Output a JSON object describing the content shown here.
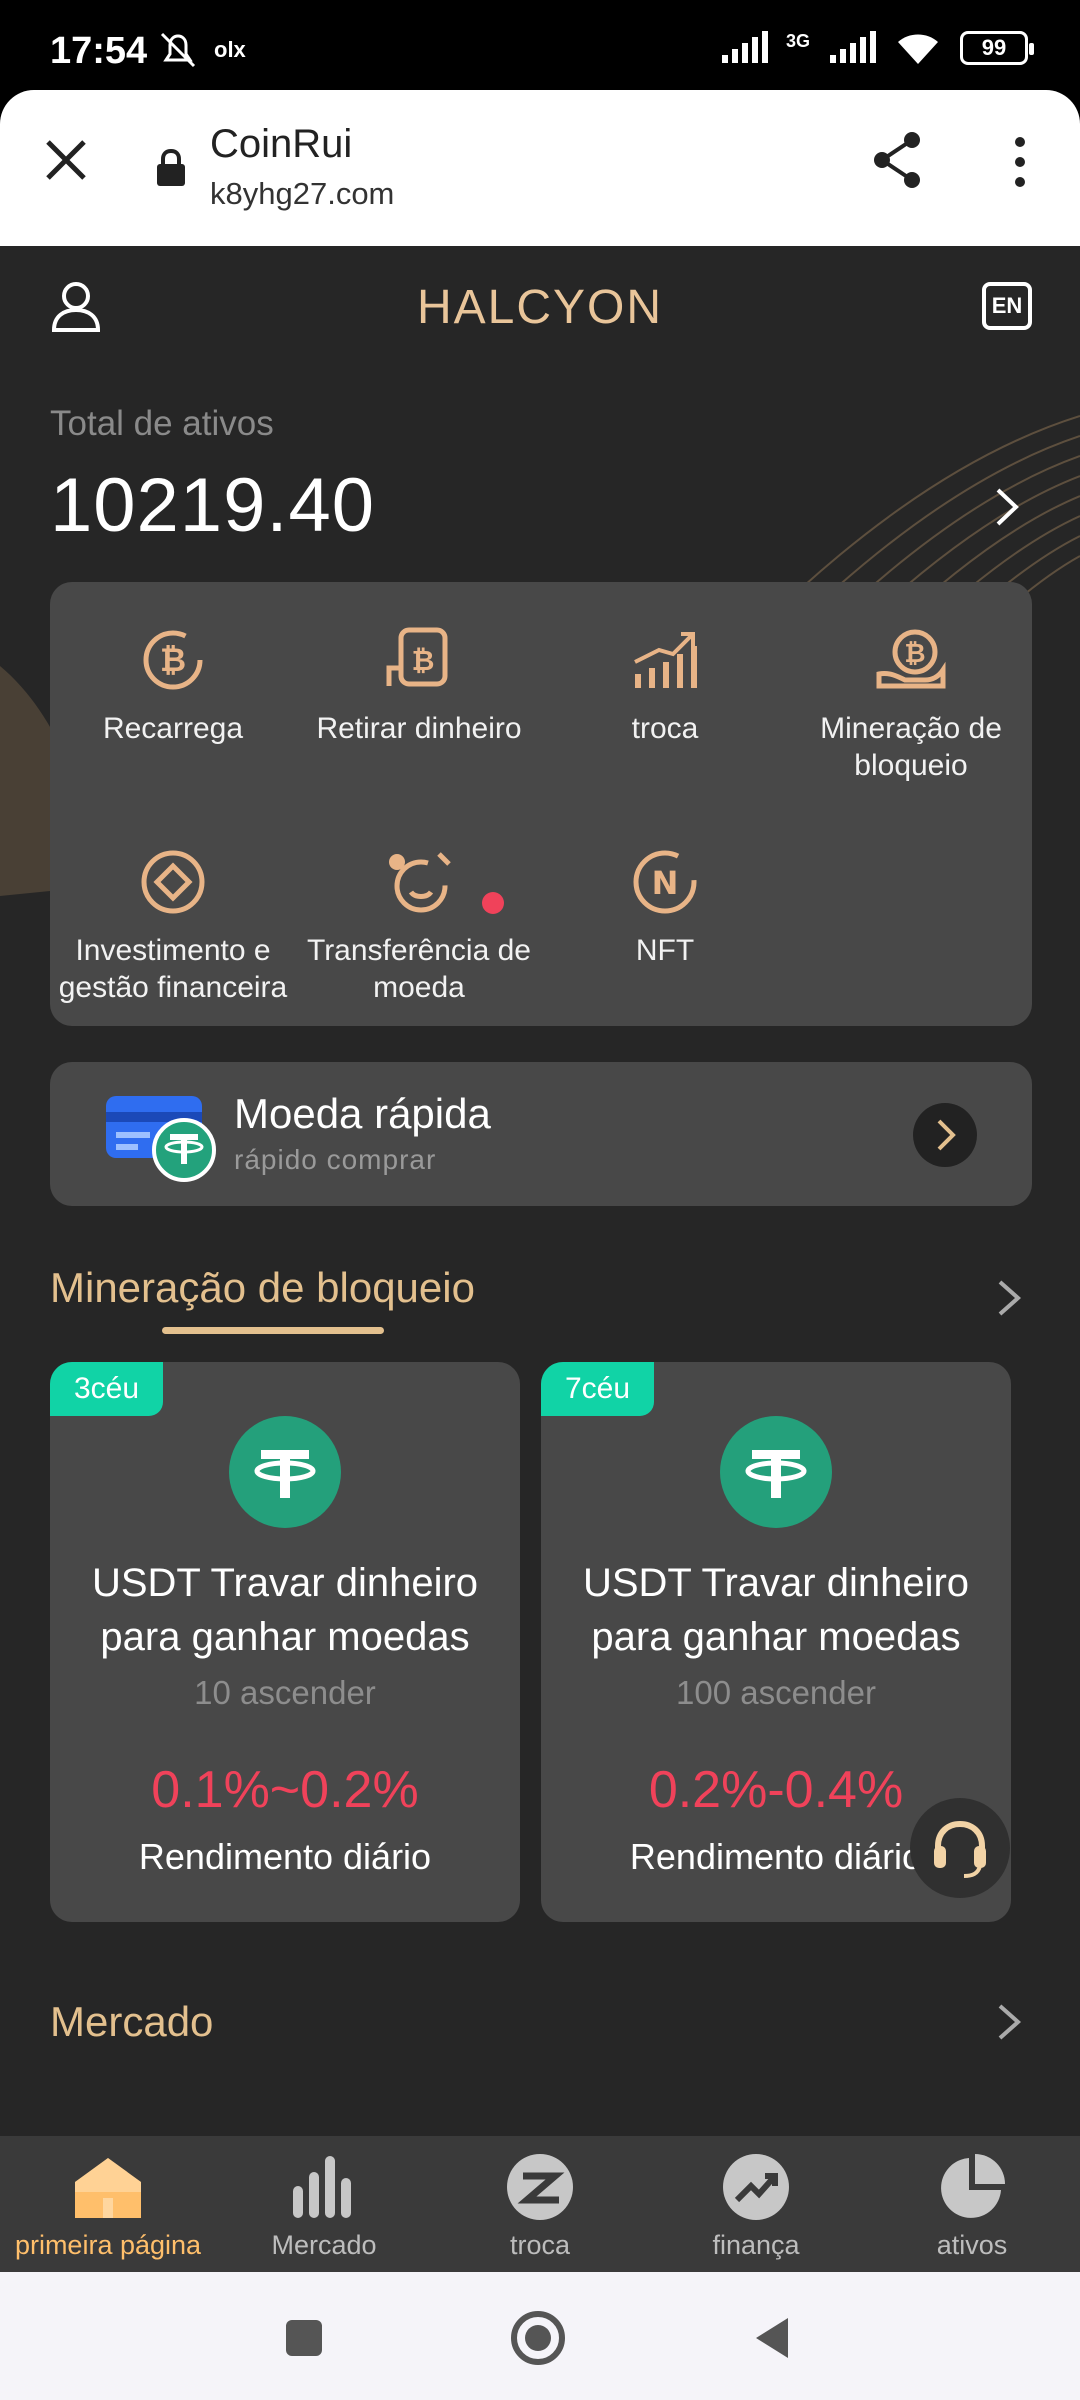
{
  "status_bar": {
    "time": "17:54",
    "network": "3G",
    "battery": "99"
  },
  "browser": {
    "title": "CoinRui",
    "url": "k8yhg27.com"
  },
  "header": {
    "brand": "HALCYON",
    "lang": "EN"
  },
  "assets": {
    "label": "Total de ativos",
    "value": "10219.40"
  },
  "menu": {
    "items": [
      {
        "label": "Recarrega",
        "icon": "bitcoin-cycle-icon"
      },
      {
        "label": "Retirar dinheiro",
        "icon": "bitcoin-withdraw-icon"
      },
      {
        "label": "troca",
        "icon": "trade-chart-icon"
      },
      {
        "label": "Mineração de bloqueio",
        "icon": "bitcoin-hand-icon"
      },
      {
        "label": "Investimento e gestão financeira",
        "icon": "diamond-circle-icon"
      },
      {
        "label": "Transferência de moeda",
        "icon": "alarm-transfer-icon"
      },
      {
        "label": "NFT",
        "icon": "nft-icon"
      }
    ]
  },
  "quick_coin": {
    "title": "Moeda rápida",
    "subtitle": "rápido comprar"
  },
  "mining_section": {
    "title": "Mineração de bloqueio",
    "cards": [
      {
        "badge": "3céu",
        "name_line1": "USDT Travar dinheiro",
        "name_line2": "para ganhar moedas",
        "min": "10 ascender",
        "rate": "0.1%~0.2%",
        "yield_label": "Rendimento diário"
      },
      {
        "badge": "7céu",
        "name_line1": "USDT Travar dinheiro",
        "name_line2": "para ganhar moedas",
        "min": "100 ascender",
        "rate": "0.2%-0.4%",
        "yield_label": "Rendimento diário"
      }
    ]
  },
  "market_section": {
    "title": "Mercado"
  },
  "bottom_nav": {
    "items": [
      {
        "label": "primeira página",
        "icon": "home-icon",
        "active": true
      },
      {
        "label": "Mercado",
        "icon": "bar-chart-icon",
        "active": false
      },
      {
        "label": "troca",
        "icon": "exchange-icon",
        "active": false
      },
      {
        "label": "finança",
        "icon": "trend-up-icon",
        "active": false
      },
      {
        "label": "ativos",
        "icon": "pie-chart-icon",
        "active": false
      }
    ]
  },
  "colors": {
    "accent": "#e3c08e",
    "rate": "#f0425a",
    "badge": "#11d3a6",
    "card": "#484848",
    "background": "#262626"
  }
}
